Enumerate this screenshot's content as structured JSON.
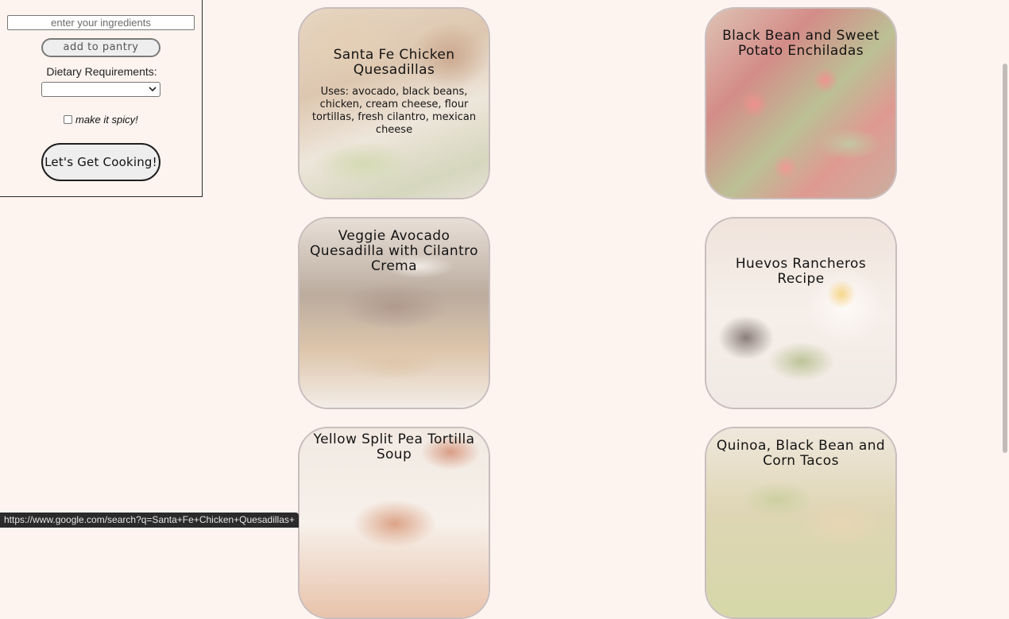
{
  "sidebar": {
    "ingredient_placeholder": "enter your ingredients",
    "pantry_button": "add to pantry",
    "diet_label": "Dietary Requirements:",
    "diet_selected": "",
    "spicy_label": "make it spicy!",
    "spicy_checked": false,
    "cook_button": "Let's Get Cooking!"
  },
  "recipes": [
    {
      "title": "Santa Fe Chicken Quesadillas",
      "uses": "Uses: avocado, black beans, chicken, cream cheese, flour tortillas, fresh cilantro, mexican cheese"
    },
    {
      "title": "Black Bean and Sweet Potato Enchiladas"
    },
    {
      "title": "Veggie Avocado Quesadilla with Cilantro Crema"
    },
    {
      "title": "Huevos Rancheros Recipe"
    },
    {
      "title": "Yellow Split Pea Tortilla Soup"
    },
    {
      "title": "Quinoa, Black Bean and Corn Tacos"
    }
  ],
  "status_url": "https://www.google.com/search?q=Santa+Fe+Chicken+Quesadillas+"
}
